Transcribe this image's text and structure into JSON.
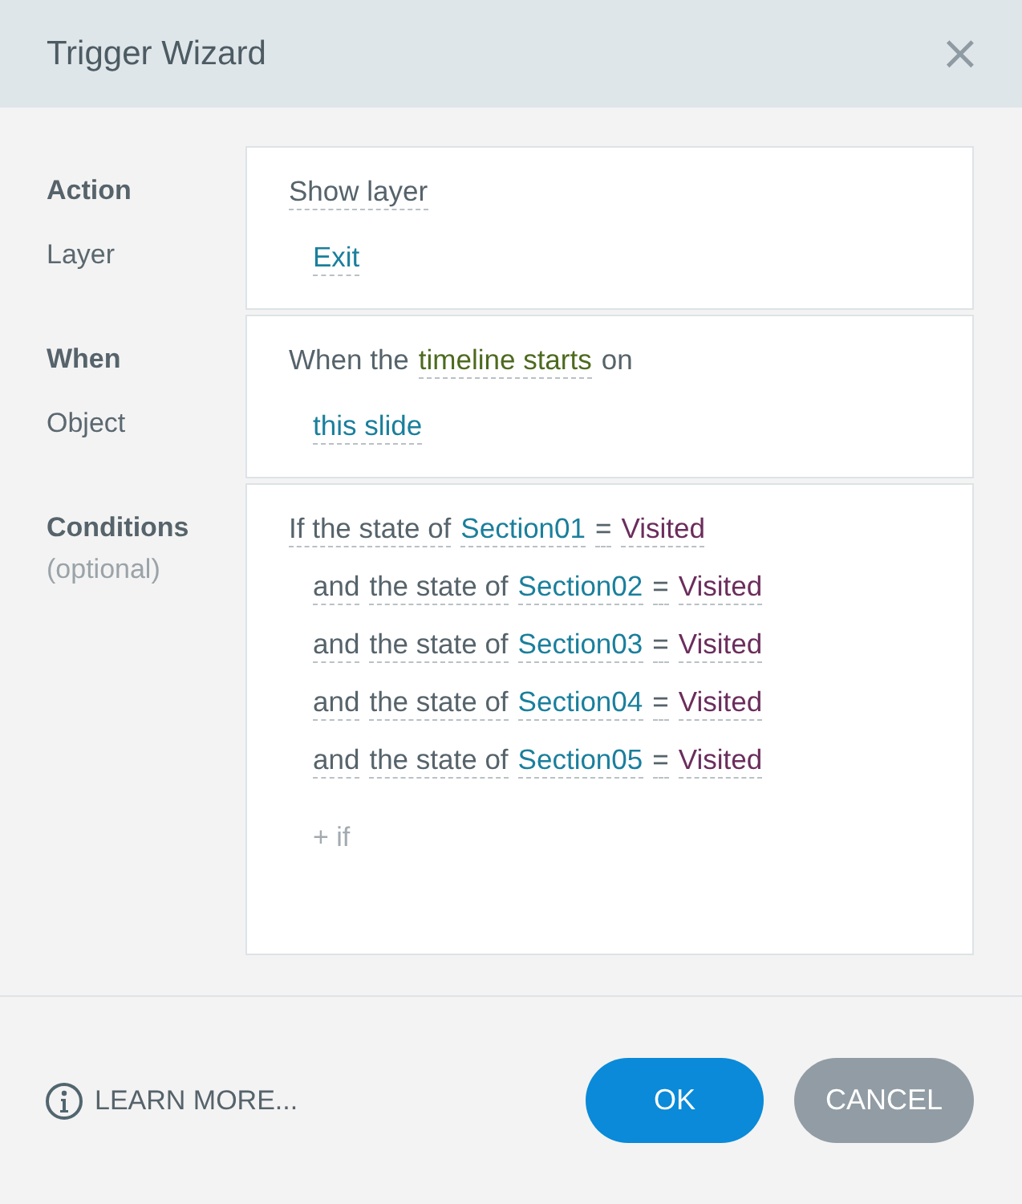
{
  "window": {
    "title": "Trigger Wizard",
    "close": "×"
  },
  "sections": [
    {
      "heading": "Action",
      "subheading": "Layer",
      "subheading_muted": false,
      "lines": [
        {
          "kind": "main",
          "tokens": [
            {
              "text": "Show layer",
              "kind": "option"
            }
          ]
        },
        {
          "kind": "detail",
          "tokens": [
            {
              "text": "Exit",
              "kind": "link"
            }
          ]
        }
      ]
    },
    {
      "heading": "When",
      "subheading": "Object",
      "subheading_muted": false,
      "lines": [
        {
          "kind": "main",
          "tokens": [
            {
              "text": "When the",
              "kind": "text"
            },
            {
              "text": "timeline starts",
              "kind": "event"
            },
            {
              "text": "on",
              "kind": "text"
            }
          ]
        },
        {
          "kind": "detail",
          "tokens": [
            {
              "text": "this slide",
              "kind": "link"
            }
          ]
        }
      ]
    },
    {
      "heading": "Conditions",
      "subheading": "(optional)",
      "subheading_muted": true,
      "lines": [
        {
          "kind": "main",
          "tokens": [
            {
              "text": "If the state of",
              "kind": "option"
            },
            {
              "text": "Section01",
              "kind": "link"
            },
            {
              "text": "=",
              "kind": "option"
            },
            {
              "text": "Visited",
              "kind": "value"
            }
          ]
        },
        {
          "kind": "detail",
          "tokens": [
            {
              "text": "and",
              "kind": "option"
            },
            {
              "text": "the state of",
              "kind": "option"
            },
            {
              "text": "Section02",
              "kind": "link"
            },
            {
              "text": "=",
              "kind": "option"
            },
            {
              "text": "Visited",
              "kind": "value"
            }
          ]
        },
        {
          "kind": "detail",
          "tokens": [
            {
              "text": "and",
              "kind": "option"
            },
            {
              "text": "the state of",
              "kind": "option"
            },
            {
              "text": "Section03",
              "kind": "link"
            },
            {
              "text": "=",
              "kind": "option"
            },
            {
              "text": "Visited",
              "kind": "value"
            }
          ]
        },
        {
          "kind": "detail",
          "tokens": [
            {
              "text": "and",
              "kind": "option"
            },
            {
              "text": "the state of",
              "kind": "option"
            },
            {
              "text": "Section04",
              "kind": "link"
            },
            {
              "text": "=",
              "kind": "option"
            },
            {
              "text": "Visited",
              "kind": "value"
            }
          ]
        },
        {
          "kind": "detail",
          "tokens": [
            {
              "text": "and",
              "kind": "option"
            },
            {
              "text": "the state of",
              "kind": "option"
            },
            {
              "text": "Section05",
              "kind": "link"
            },
            {
              "text": "=",
              "kind": "option"
            },
            {
              "text": "Visited",
              "kind": "value"
            }
          ]
        }
      ],
      "add": "+ if"
    }
  ],
  "footer": {
    "learn_more": "LEARN MORE...",
    "buttons": [
      {
        "label": "OK",
        "kind": "primary"
      },
      {
        "label": "CANCEL",
        "kind": "secondary"
      }
    ]
  }
}
